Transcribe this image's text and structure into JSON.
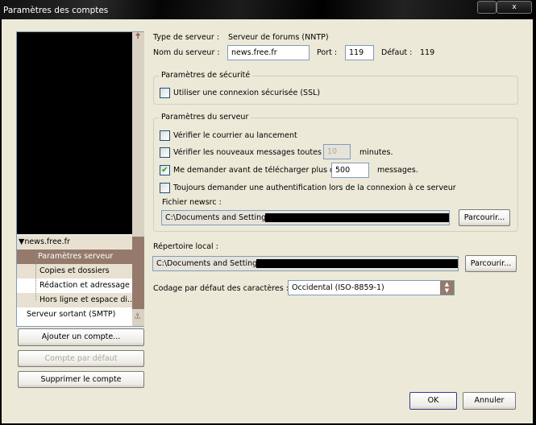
{
  "window": {
    "title": "Paramètres des comptes",
    "close_glyph": "x"
  },
  "tree": {
    "items": [
      {
        "label": "news.free.fr",
        "expander": "▼"
      },
      {
        "label": "Paramètres serveur"
      },
      {
        "label": "Copies et dossiers"
      },
      {
        "label": "Rédaction et adressage"
      },
      {
        "label": "Hors ligne et espace di..."
      },
      {
        "label": "Serveur sortant (SMTP)"
      }
    ],
    "scroll_up": "✝",
    "scroll_down": "⚓"
  },
  "left_buttons": {
    "add": "Ajouter un compte...",
    "default": "Compte par défaut",
    "delete": "Supprimer le compte"
  },
  "server": {
    "type_label": "Type de serveur :",
    "type_value": "Serveur de forums (NNTP)",
    "name_label": "Nom du serveur :",
    "name_value": "news.free.fr",
    "port_label": "Port :",
    "port_value": "119",
    "default_label": "Défaut :",
    "default_value": "119"
  },
  "security": {
    "legend": "Paramètres de sécurité",
    "ssl_label": "Utiliser une connexion sécurisée (SSL)",
    "ssl_checked": false
  },
  "server_settings": {
    "legend": "Paramètres du serveur",
    "check_startup": "Vérifier le courrier au lancement",
    "check_every": "Vérifier les nouveaux messages toutes les",
    "check_every_value": "10",
    "minutes": "minutes.",
    "ask_before": "Me demander avant de télécharger plus de",
    "ask_before_value": "500",
    "messages": "messages.",
    "always_auth": "Toujours demander une authentification lors de la connexion à ce serveur",
    "newsrc_label": "Fichier newsrc :",
    "newsrc_value": "C:\\Documents and Settings",
    "browse": "Parcourir..."
  },
  "local": {
    "label": "Répertoire local :",
    "value": "C:\\Documents and Settings",
    "browse": "Parcourir..."
  },
  "encoding": {
    "label": "Codage par défaut des caractères :",
    "value": "Occidental (ISO-8859-1)"
  },
  "footer": {
    "ok": "OK",
    "cancel": "Annuler"
  }
}
